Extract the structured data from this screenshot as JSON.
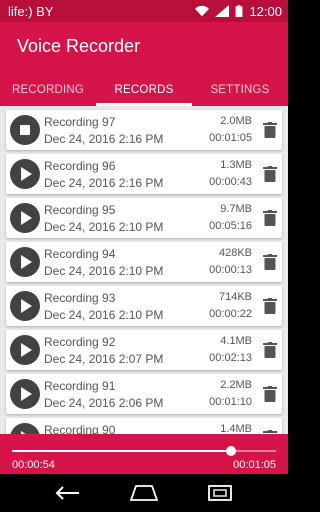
{
  "status_bar": {
    "carrier": "life:) BY",
    "time": "12:00"
  },
  "app": {
    "title": "Voice Recorder"
  },
  "tabs": [
    {
      "label": "RECORDING",
      "active": false
    },
    {
      "label": "RECORDS",
      "active": true
    },
    {
      "label": "SETTINGS",
      "active": false
    }
  ],
  "recordings": [
    {
      "name": "Recording 97",
      "date": "Dec 24, 2016 2:16 PM",
      "size": "2.0MB",
      "duration": "00:01:05",
      "state": "playing"
    },
    {
      "name": "Recording 96",
      "date": "Dec 24, 2016 2:16 PM",
      "size": "1.3MB",
      "duration": "00:00:43",
      "state": "stopped"
    },
    {
      "name": "Recording 95",
      "date": "Dec 24, 2016 2:10 PM",
      "size": "9.7MB",
      "duration": "00:05:16",
      "state": "stopped"
    },
    {
      "name": "Recording 94",
      "date": "Dec 24, 2016 2:10 PM",
      "size": "428KB",
      "duration": "00:00:13",
      "state": "stopped"
    },
    {
      "name": "Recording 93",
      "date": "Dec 24, 2016 2:10 PM",
      "size": "714KB",
      "duration": "00:00:22",
      "state": "stopped"
    },
    {
      "name": "Recording 92",
      "date": "Dec 24, 2016 2:07 PM",
      "size": "4.1MB",
      "duration": "00:02:13",
      "state": "stopped"
    },
    {
      "name": "Recording 91",
      "date": "Dec 24, 2016 2:06 PM",
      "size": "2.2MB",
      "duration": "00:01:10",
      "state": "stopped"
    },
    {
      "name": "Recording 90",
      "date": "",
      "size": "1.4MB",
      "duration": "",
      "state": "stopped"
    }
  ],
  "player": {
    "current": "00:00:54",
    "total": "00:01:05",
    "progress": 0.83
  },
  "colors": {
    "primary": "#d5154a",
    "status_bar": "#b80f3a",
    "list_bg": "#e8e8e8"
  },
  "icons": {
    "play": "play-icon",
    "stop": "stop-icon",
    "delete": "trash-icon"
  }
}
